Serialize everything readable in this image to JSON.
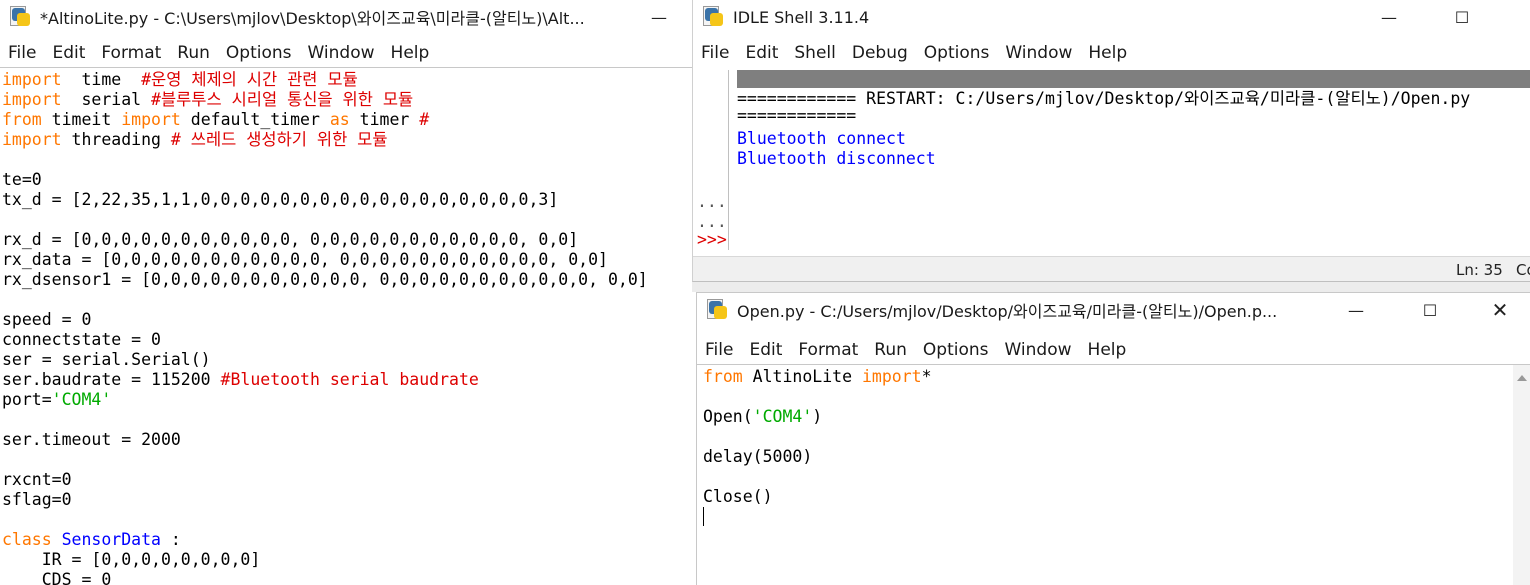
{
  "editor_left": {
    "title": "*AltinoLite.py - C:\\Users\\mjlov\\Desktop\\와이즈교육\\미라클-(알티노)\\Alt...",
    "minimize": "—",
    "menu": [
      "File",
      "Edit",
      "Format",
      "Run",
      "Options",
      "Window",
      "Help"
    ],
    "lines": [
      [
        [
          "kw",
          "import"
        ],
        [
          "",
          "  time  "
        ],
        [
          "cm",
          "#운영 체제의 시간 관련 모듈"
        ]
      ],
      [
        [
          "kw",
          "import"
        ],
        [
          "",
          "  serial "
        ],
        [
          "cm",
          "#블루투스 시리얼 통신을 위한 모듈"
        ]
      ],
      [
        [
          "kw",
          "from"
        ],
        [
          "",
          " timeit "
        ],
        [
          "kw",
          "import"
        ],
        [
          "",
          " default_timer "
        ],
        [
          "kw",
          "as"
        ],
        [
          "",
          " timer "
        ],
        [
          "cm",
          "#"
        ]
      ],
      [
        [
          "kw",
          "import"
        ],
        [
          "",
          " threading "
        ],
        [
          "cm",
          "# 쓰레드 생성하기 위한 모듈"
        ]
      ],
      [
        [
          "",
          ""
        ]
      ],
      [
        [
          "",
          "te=0"
        ]
      ],
      [
        [
          "",
          "tx_d = [2,22,35,1,1,0,0,0,0,0,0,0,0,0,0,0,0,0,0,0,0,0,3]"
        ]
      ],
      [
        [
          "",
          ""
        ]
      ],
      [
        [
          "",
          "rx_d = [0,0,0,0,0,0,0,0,0,0,0, 0,0,0,0,0,0,0,0,0,0,0, 0,0]"
        ]
      ],
      [
        [
          "",
          "rx_data = [0,0,0,0,0,0,0,0,0,0,0, 0,0,0,0,0,0,0,0,0,0,0, 0,0]"
        ]
      ],
      [
        [
          "",
          "rx_dsensor1 = [0,0,0,0,0,0,0,0,0,0,0, 0,0,0,0,0,0,0,0,0,0,0, 0,0]"
        ]
      ],
      [
        [
          "",
          ""
        ]
      ],
      [
        [
          "",
          "speed = 0"
        ]
      ],
      [
        [
          "",
          "connectstate = 0"
        ]
      ],
      [
        [
          "",
          "ser = serial.Serial()"
        ]
      ],
      [
        [
          "",
          "ser.baudrate = 115200 "
        ],
        [
          "cm",
          "#Bluetooth serial baudrate"
        ]
      ],
      [
        [
          "",
          "port="
        ],
        [
          "str",
          "'COM4'"
        ]
      ],
      [
        [
          "",
          ""
        ]
      ],
      [
        [
          "",
          "ser.timeout = 2000"
        ]
      ],
      [
        [
          "",
          ""
        ]
      ],
      [
        [
          "",
          "rxcnt=0"
        ]
      ],
      [
        [
          "",
          "sflag=0"
        ]
      ],
      [
        [
          "",
          ""
        ]
      ],
      [
        [
          "kw",
          "class"
        ],
        [
          "",
          " "
        ],
        [
          "cls",
          "SensorData"
        ],
        [
          "",
          " :"
        ]
      ],
      [
        [
          "",
          "    IR = [0,0,0,0,0,0,0,0]"
        ]
      ],
      [
        [
          "",
          "    CDS = 0"
        ]
      ]
    ]
  },
  "shell": {
    "title": "IDLE Shell 3.11.4",
    "minimize": "—",
    "maximize": "☐",
    "menu": [
      "File",
      "Edit",
      "Shell",
      "Debug",
      "Options",
      "Window",
      "Help"
    ],
    "restart_line": "============ RESTART: C:/Users/mjlov/Desktop/와이즈교육/미라클-(알티노)/Open.py",
    "restart_line2": "============",
    "output": [
      "Bluetooth connect",
      "Bluetooth disconnect"
    ],
    "gutter": [
      "...",
      "...",
      ">>>"
    ],
    "status": "Ln: 35",
    "status_col": "Co"
  },
  "open_editor": {
    "title": "Open.py - C:/Users/mjlov/Desktop/와이즈교육/미라클-(알티노)/Open.p...",
    "minimize": "—",
    "maximize": "☐",
    "close": "✕",
    "menu": [
      "File",
      "Edit",
      "Format",
      "Run",
      "Options",
      "Window",
      "Help"
    ],
    "lines": [
      [
        [
          "kw",
          "from"
        ],
        [
          "",
          " AltinoLite "
        ],
        [
          "kw",
          "import"
        ],
        [
          "",
          "*"
        ]
      ],
      [
        [
          "",
          ""
        ]
      ],
      [
        [
          "",
          "Open("
        ],
        [
          "str",
          "'COM4'"
        ],
        [
          "",
          ")"
        ]
      ],
      [
        [
          "",
          ""
        ]
      ],
      [
        [
          "",
          "delay(5000)"
        ]
      ],
      [
        [
          "",
          ""
        ]
      ],
      [
        [
          "",
          "Close()"
        ]
      ]
    ]
  }
}
